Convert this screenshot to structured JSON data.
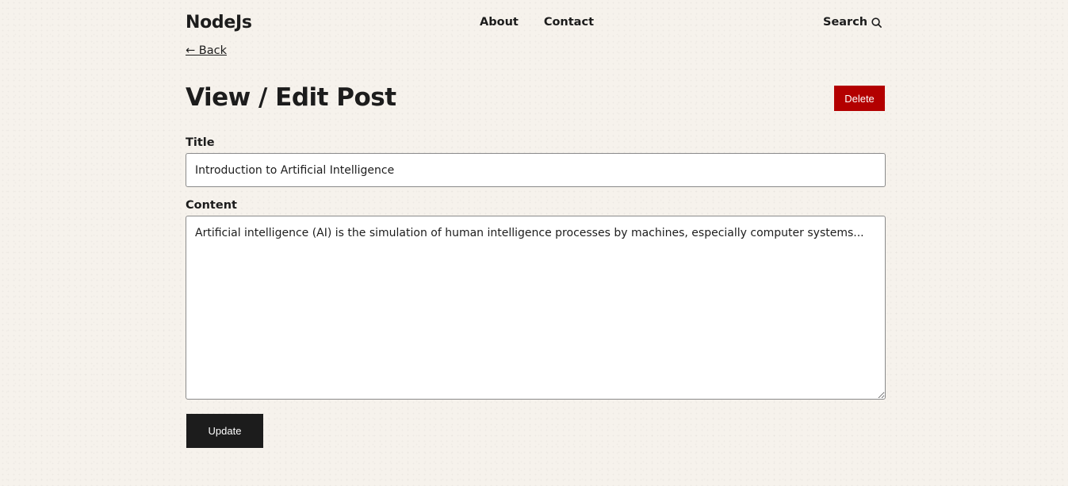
{
  "header": {
    "logo": "NodeJs",
    "nav": [
      {
        "label": "About"
      },
      {
        "label": "Contact"
      }
    ],
    "search_label": "Search",
    "search_icon": "search-icon"
  },
  "back_link": "← Back",
  "page_title": "View / Edit Post",
  "delete_label": "Delete",
  "form": {
    "title_label": "Title",
    "title_value": "Introduction to Artificial Intelligence",
    "content_label": "Content",
    "content_value": "Artificial intelligence (AI) is the simulation of human intelligence processes by machines, especially computer systems...",
    "update_label": "Update"
  },
  "colors": {
    "background": "#f6f2ec",
    "text": "#1c1c1c",
    "delete": "#b30000",
    "update": "#1c1c1c"
  }
}
